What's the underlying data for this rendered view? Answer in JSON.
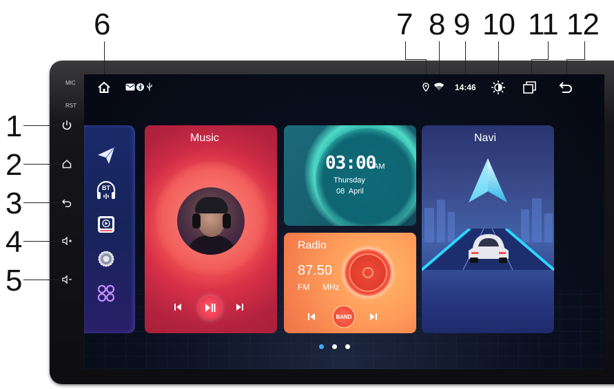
{
  "callouts": {
    "n1": "1",
    "n2": "2",
    "n3": "3",
    "n4": "4",
    "n5": "5",
    "n6": "6",
    "n7": "7",
    "n8": "8",
    "n9": "9",
    "n10": "10",
    "n11": "11",
    "n12": "12"
  },
  "bezel": {
    "mic_label": "MIC",
    "rst_label": "RST"
  },
  "side_buttons": [
    "power-icon",
    "home-icon",
    "back-icon",
    "volume-up-icon",
    "volume-down-icon"
  ],
  "status": {
    "time": "14:46"
  },
  "dock": {
    "bt_label": "BT"
  },
  "music": {
    "title": "Music"
  },
  "clock": {
    "time": "03:00",
    "ampm": "AM",
    "day": "Thursday",
    "date": "08  April"
  },
  "radio": {
    "title": "Radio",
    "frequency": "87.50",
    "band": "FM",
    "unit": "MHz",
    "band_button": "BAND"
  },
  "navi": {
    "title": "Navi"
  },
  "colors": {
    "music": "#e8424a",
    "clock": "#1b6a78",
    "radio": "#ff9e5c",
    "navi": "#3a4a8a",
    "pager_active": "#3fa9ff"
  }
}
